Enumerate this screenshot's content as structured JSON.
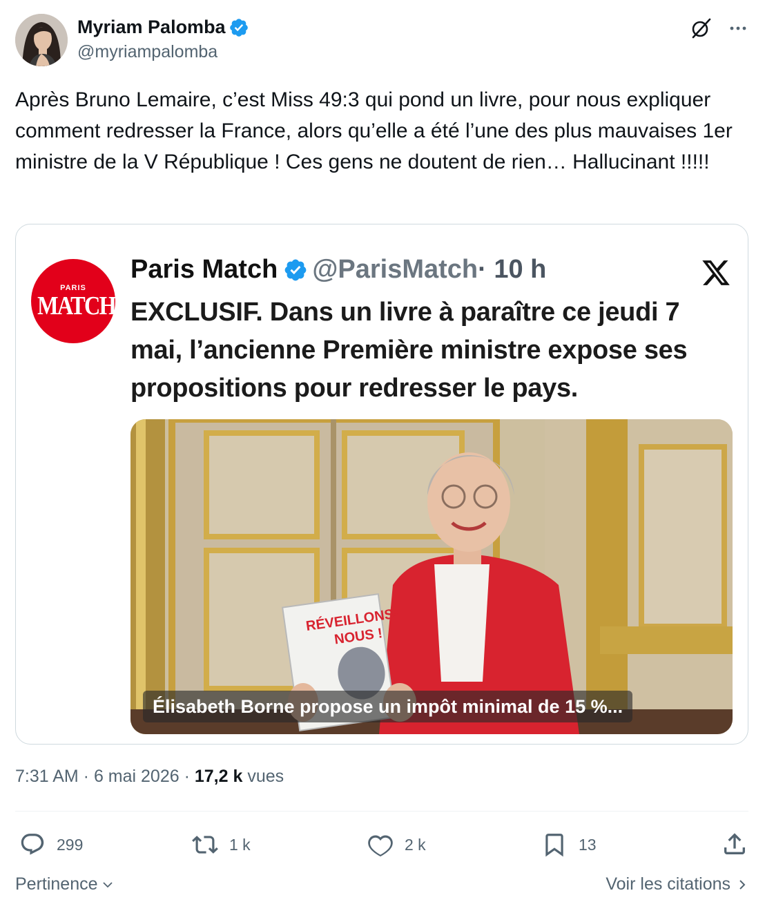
{
  "author": {
    "display_name": "Myriam Palomba",
    "handle": "@myriampalomba",
    "verified": true
  },
  "tweet": {
    "text": "Après Bruno Lemaire, c’est Miss 49:3 qui pond un livre, pour nous expliquer comment redresser la France, alors qu’elle a été l’une des plus mauvaises 1er ministre de la V République ! Ces gens ne doutent de rien… Hallucinant !!!!!"
  },
  "quoted_post": {
    "logo_small": "PARIS",
    "logo_main": "MATCH",
    "display_name": "Paris Match",
    "handle": "@ParisMatch",
    "time": "· 10 h",
    "text": "EXCLUSIF. Dans un livre à paraître ce jeudi 7 mai, l’ancienne Première ministre expose ses propositions pour redresser le pays.",
    "image_caption": "Élisabeth Borne propose un impôt minimal de 15 %..."
  },
  "meta": {
    "time": "7:31 AM",
    "separator1": " · ",
    "date": "6 mai 2026",
    "separator2": " · ",
    "views_count": "17,2 k",
    "views_label": " vues"
  },
  "actions": {
    "replies": "299",
    "reposts": "1 k",
    "likes": "2 k",
    "bookmarks": "13"
  },
  "footer": {
    "sort_label": "Pertinence",
    "quotes_link": "Voir les citations"
  },
  "colors": {
    "text_primary": "#0f1419",
    "text_secondary": "#536471",
    "verified_blue": "#1d9bf0",
    "border": "#cfd9de",
    "match_red": "#e2001a"
  },
  "icons": {
    "grok": "grok-icon",
    "more": "more-icon",
    "reply": "reply-icon",
    "repost": "repost-icon",
    "like": "heart-icon",
    "bookmark": "bookmark-icon",
    "share": "share-icon"
  }
}
